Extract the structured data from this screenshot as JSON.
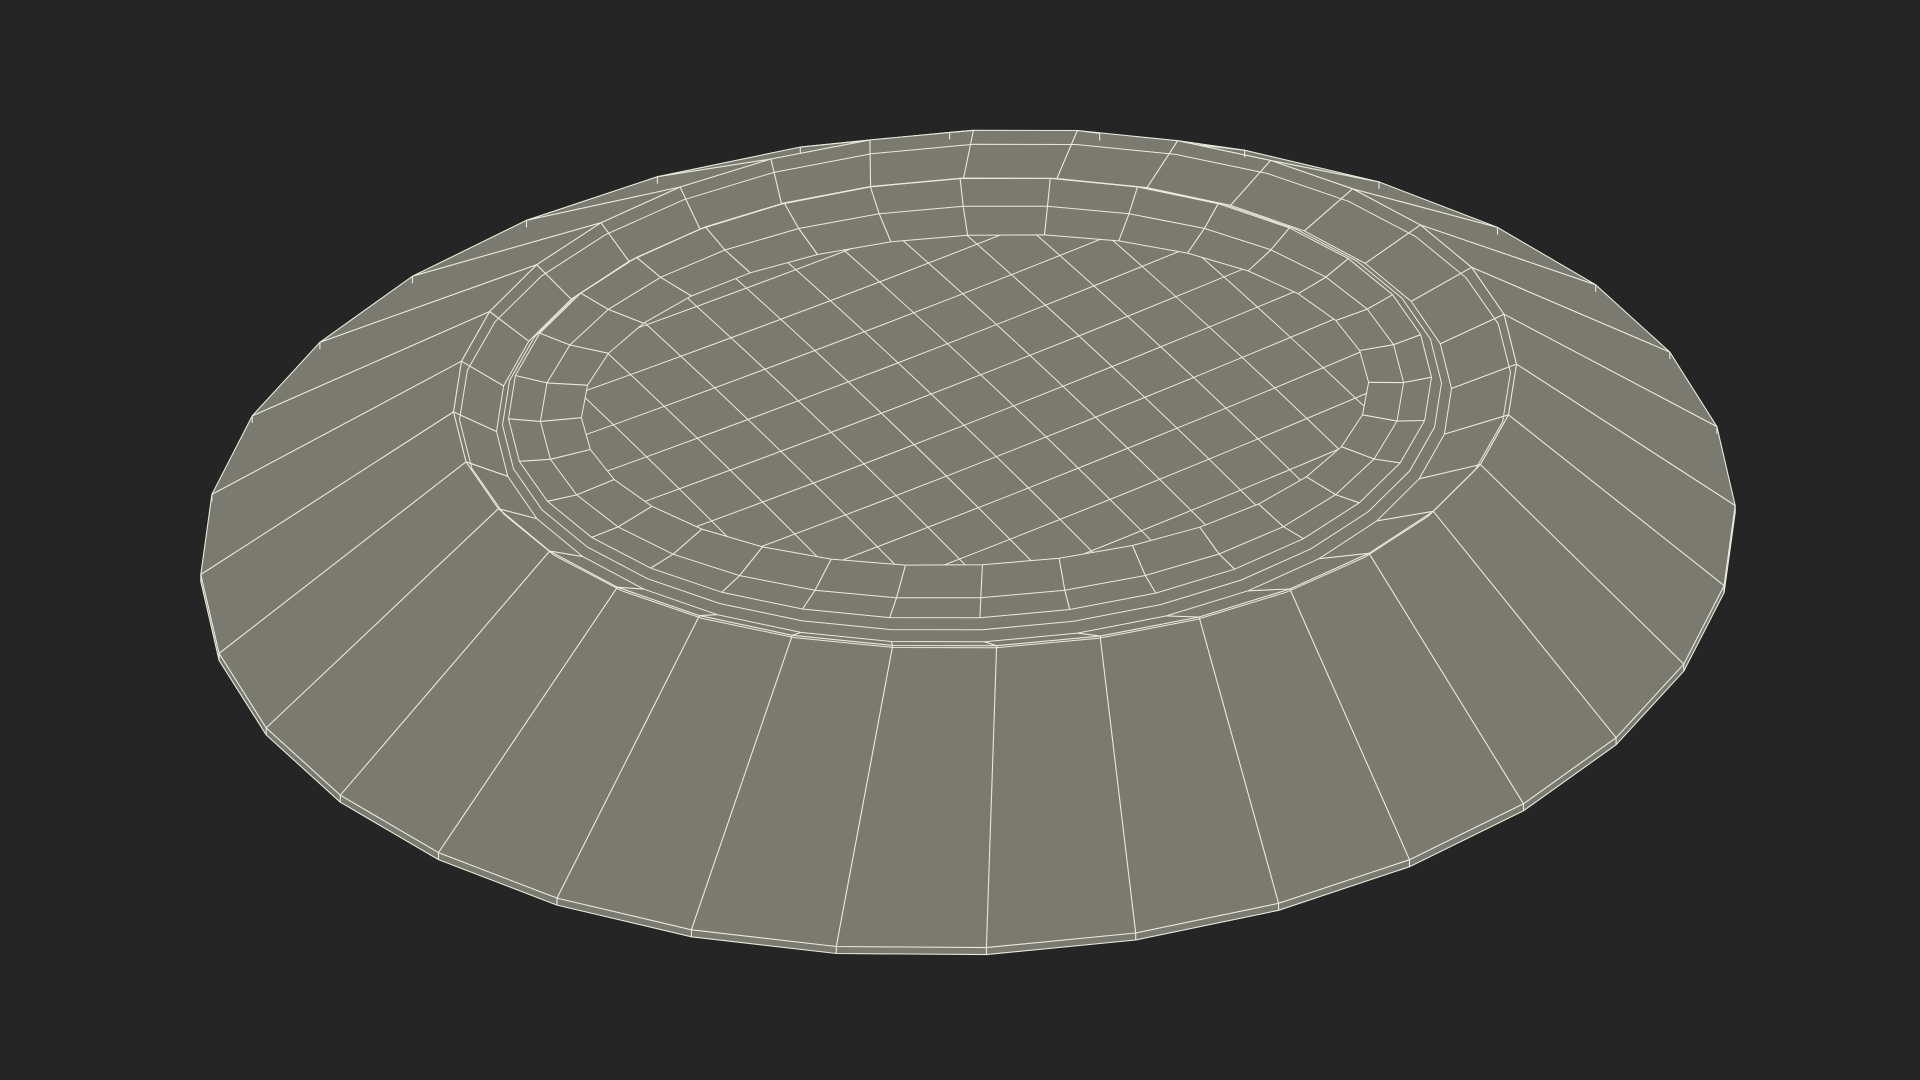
{
  "viewport": {
    "background_color": "#252525",
    "object": "plate-wireframe"
  },
  "mesh": {
    "fill_color": "#7a7a70",
    "wire_color": "#e9e9dc",
    "shading": "flat-wireframe"
  }
}
